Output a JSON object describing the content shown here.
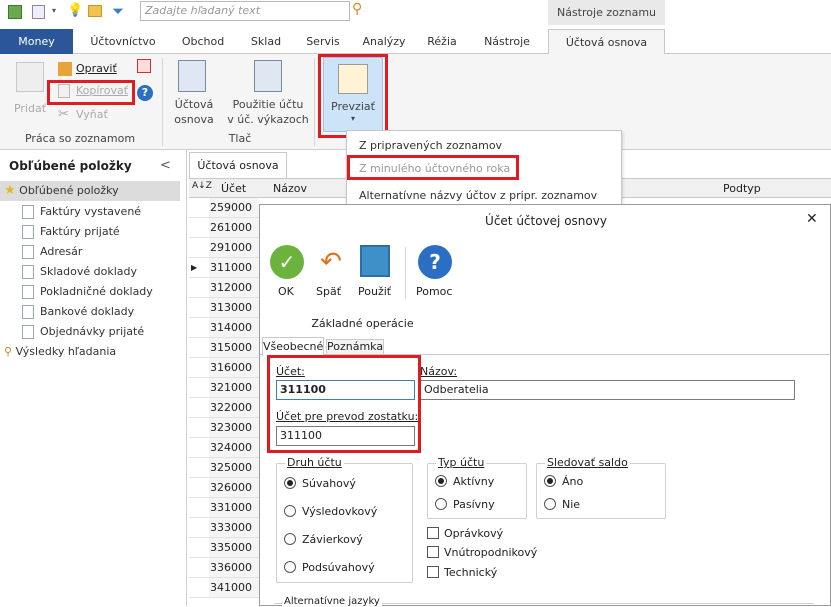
{
  "search": {
    "placeholder": "Zadajte hľadaný text"
  },
  "context_tab_group": "Nástroje zoznamu",
  "menu": {
    "tabs": [
      "Money",
      "Účtovníctvo",
      "Obchod",
      "Sklad",
      "Servis",
      "Analýzy",
      "Réžia",
      "Nástroje",
      "Účtová osnova"
    ]
  },
  "ribbon": {
    "pridat": "Pridať",
    "opravit": "Opraviť",
    "kopirovat": "Kopírovať",
    "vymat": "Vyňať",
    "group1": "Práca so zoznamom",
    "uctova1": "Účtová",
    "uctova2": "osnova",
    "pouzitie1": "Použitie účtu",
    "pouzitie2": "v úč. výkazoch",
    "group2": "Tlač",
    "prevziat": "Prevziať"
  },
  "dropdown": {
    "items": [
      "Z pripravených zoznamov",
      "Z minulého účtovného roka",
      "Alternatívne názvy účtov z pripr. zoznamov"
    ]
  },
  "leftpane": {
    "title": "Obľúbené položky",
    "collapse": "<",
    "root": "Obľúbené položky",
    "items": [
      "Faktúry vystavené",
      "Faktúry prijaté",
      "Adresár",
      "Skladové doklady",
      "Pokladničné doklady",
      "Bankové doklady",
      "Objednávky prijaté"
    ],
    "search_results": "Výsledky hľadania"
  },
  "grid": {
    "tab": "Účtová osnova",
    "col_ucet": "Účet",
    "col_nazov": "Názov",
    "col_podtyp": "Podtyp",
    "rows": [
      "259000",
      "261000",
      "291000",
      "311000",
      "312000",
      "313000",
      "314000",
      "315000",
      "316000",
      "321000",
      "322000",
      "323000",
      "324000",
      "325000",
      "326000",
      "331000",
      "333000",
      "335000",
      "336000",
      "341000"
    ]
  },
  "dialog": {
    "title": "Účet účtovej osnovy",
    "ok": "OK",
    "spat": "Späť",
    "pouzit": "Použiť",
    "pomoc": "Pomoc",
    "group": "Základné operácie",
    "tab1": "Všeobecné",
    "tab2": "Poznámka",
    "ucet_label": "Účet:",
    "ucet_value": "311100",
    "nazov_label": "Názov:",
    "nazov_value": "Odberatelia",
    "prevod_label": "Účet pre prevod zostatku:",
    "prevod_value": "311100",
    "druh_title": "Druh účtu",
    "druh_options": [
      "Súvahový",
      "Výsledovkový",
      "Závierkový",
      "Podsúvahový"
    ],
    "typ_title": "Typ účtu",
    "typ_options": [
      "Aktívny",
      "Pasívny"
    ],
    "saldo_title": "Sledovať saldo",
    "saldo_options": [
      "Áno",
      "Nie"
    ],
    "checks": [
      "Oprávkový",
      "Vnútropodnikový",
      "Technický"
    ],
    "alt_title": "Alternatívne jazyky",
    "close": "✕"
  },
  "colors": {
    "accent": "#2b579a",
    "highlight": "#e01b22"
  }
}
